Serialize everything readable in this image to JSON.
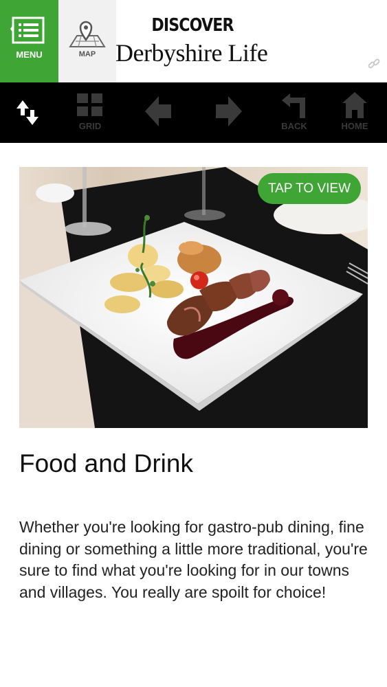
{
  "header": {
    "menu_label": "MENU",
    "map_label": "MAP",
    "brand_top": "DISCOVER",
    "brand_main": "Derbyshire Life"
  },
  "toolbar": {
    "grid_label": "GRID",
    "back_label": "BACK",
    "home_label": "HOME"
  },
  "content": {
    "tap_label": "TAP TO VIEW",
    "title": "Food and Drink",
    "description": "Whether you're looking for gastro-pub dining, fine dining or something a little more traditional, you're sure to find what you're looking for in our towns and villages. You really are spoilt for choice!"
  },
  "colors": {
    "accent": "#3fa535",
    "toolbar_bg": "#000000",
    "toolbar_icon": "#3a3a3a"
  }
}
